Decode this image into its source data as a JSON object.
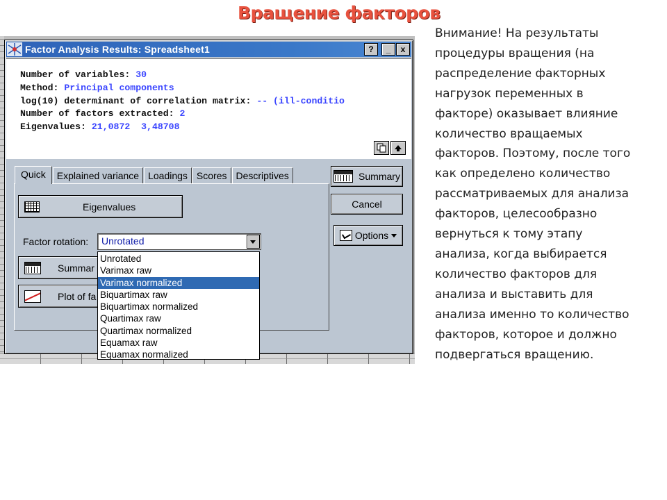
{
  "slide": {
    "title": "Вращение факторов",
    "note_lines": [
      "Внимание! На результаты",
      "процедуры вращения (на",
      "распределение факторных",
      "нагрузок переменных в",
      "факторе) оказывает влияние",
      "количество вращаемых",
      "факторов. Поэтому, после того",
      "как определено количество",
      "рассматриваемых для анализа",
      "факторов, целесообразно",
      "вернуться к тому этапу",
      "анализа, когда выбирается",
      "количество факторов для",
      "анализа и выставить для",
      "анализа именно то количество",
      "факторов, которое и должно",
      "подвергаться вращению."
    ]
  },
  "window": {
    "title": "Factor Analysis Results: Spreadsheet1",
    "buttons": {
      "help": "?",
      "minimize": "_",
      "close": "x"
    }
  },
  "output": {
    "lines": [
      {
        "label": "Number of variables:",
        "value": "30"
      },
      {
        "label": "Method:",
        "value": "Principal components"
      },
      {
        "label": "log(10) determinant of correlation matrix:",
        "value": "-- (ill-conditio"
      },
      {
        "label": "Number of factors extracted:",
        "value": "2"
      },
      {
        "label": "Eigenvalues:",
        "value": "21,0872  3,48708"
      }
    ],
    "scroll_top_label": "⇞"
  },
  "tabs": [
    "Quick",
    "Explained variance",
    "Loadings",
    "Scores",
    "Descriptives"
  ],
  "quick": {
    "eigenvalues_button": "Eigenvalues",
    "rotation_label": "Factor rotation:",
    "rotation_selected": "Unrotated",
    "rotation_options": [
      "Unrotated",
      "Varimax raw",
      "Varimax normalized",
      "Biquartimax raw",
      "Biquartimax normalized",
      "Quartimax raw",
      "Quartimax normalized",
      "Equamax raw",
      "Equamax normalized"
    ],
    "highlighted_option": "Varimax normalized",
    "summary_button_partial": "Summar",
    "plot_button_partial": "Plot of fa"
  },
  "side_buttons": {
    "summary": "Summary",
    "cancel": "Cancel",
    "options": "Options"
  },
  "colors": {
    "title": "#e8523f",
    "titlebar": "#2f63b8",
    "window_face": "#bcc6d2",
    "output_value": "#3a45ff",
    "selection": "#2f6ab3"
  }
}
